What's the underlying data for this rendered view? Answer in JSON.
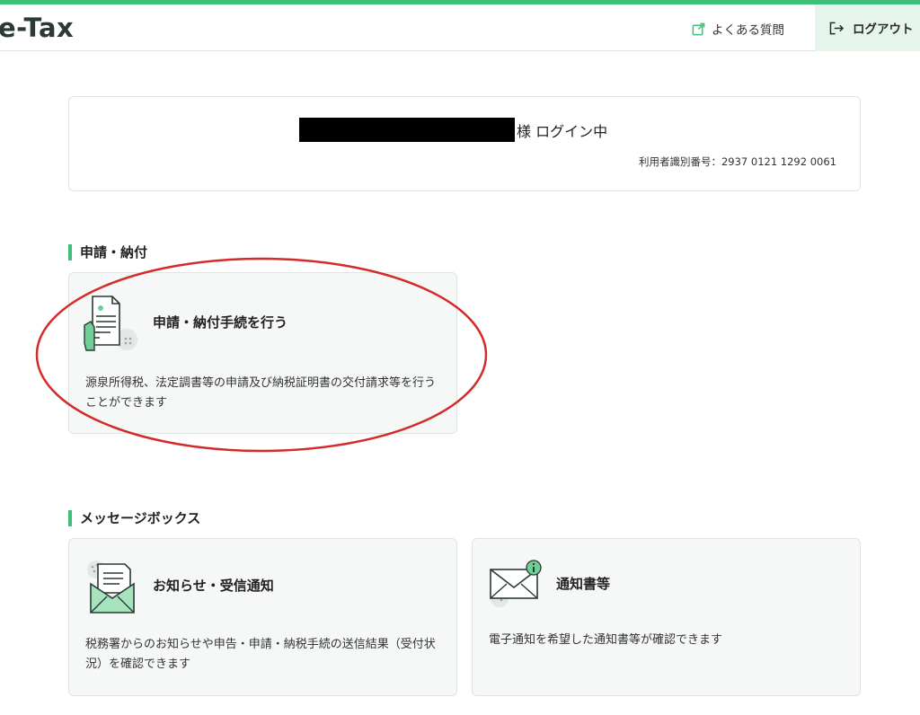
{
  "header": {
    "logo": "e-Tax",
    "faq_label": "よくある質問",
    "logout_label": "ログアウト"
  },
  "user_box": {
    "login_status": "様 ログイン中",
    "user_id": "利用者識別番号：2937 0121 1292 0061"
  },
  "sections": {
    "application": {
      "title": "申請・納付",
      "card": {
        "title": "申請・納付手続を行う",
        "description": "源泉所得税、法定調書等の申請及び納税証明書の交付請求等を行うことができます"
      }
    },
    "message_box": {
      "title": "メッセージボックス",
      "cards": [
        {
          "title": "お知らせ・受信通知",
          "description": "税務署からのお知らせや申告・申請・納税手続の送信結果（受付状況）を確認できます"
        },
        {
          "title": "通知書等",
          "description": "電子通知を希望した通知書等が確認できます"
        }
      ]
    }
  },
  "colors": {
    "accent": "#3fbf7a",
    "logout_bg": "#e6f5ec",
    "card_bg": "#f5f8f7",
    "annotation_red": "#d42a2a"
  },
  "icons": {
    "faq": "external-link-icon",
    "logout": "logout-arrow-icon",
    "application": "document-hand-icon",
    "notices": "envelope-letter-icon",
    "notifications": "envelope-info-icon"
  }
}
